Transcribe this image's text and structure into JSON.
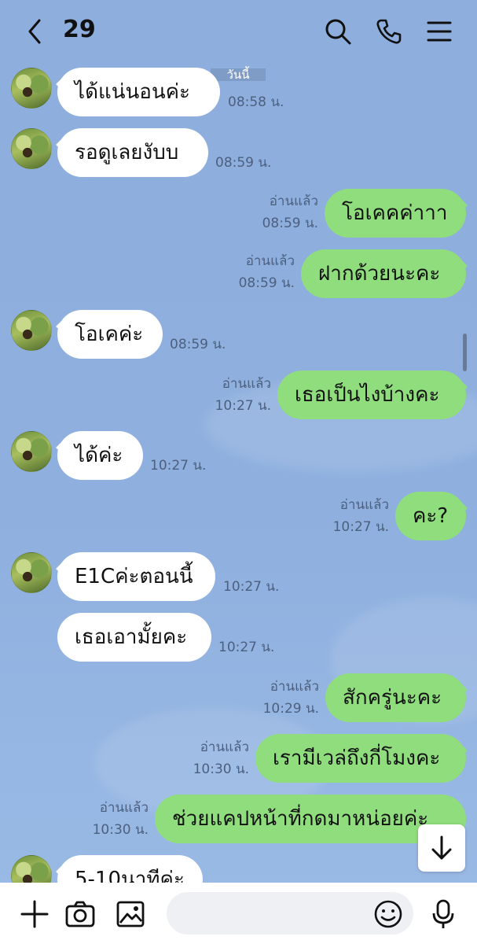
{
  "header": {
    "title": "29",
    "icons": [
      "back-icon",
      "search-icon",
      "phone-icon",
      "menu-icon"
    ]
  },
  "date_label": "วันนี้",
  "messages": [
    {
      "dir": "in",
      "text": "ได้แน่นอนค่ะ",
      "time": "08:58 น.",
      "read": ""
    },
    {
      "dir": "in",
      "text": "รอดูเลยงับบ",
      "time": "08:59 น.",
      "read": ""
    },
    {
      "dir": "out",
      "text": "โอเคคค่าาา",
      "time": "08:59 น.",
      "read": "อ่านแล้ว"
    },
    {
      "dir": "out",
      "text": "ฝากด้วยนะคะ",
      "time": "08:59 น.",
      "read": "อ่านแล้ว"
    },
    {
      "dir": "in",
      "text": "โอเคค่ะ",
      "time": "08:59 น.",
      "read": ""
    },
    {
      "dir": "out",
      "text": "เธอเป็นไงบ้างคะ",
      "time": "10:27 น.",
      "read": "อ่านแล้ว"
    },
    {
      "dir": "in",
      "text": "ได้ค่ะ",
      "time": "10:27 น.",
      "read": ""
    },
    {
      "dir": "out",
      "text": "คะ?",
      "time": "10:27 น.",
      "read": "อ่านแล้ว"
    },
    {
      "dir": "in",
      "text": "E1Cค่ะตอนนี้",
      "time": "10:27 น.",
      "read": ""
    },
    {
      "dir": "in",
      "text": "เธอเอามั้ยคะ",
      "time": "10:27 น.",
      "read": ""
    },
    {
      "dir": "out",
      "text": "สักครู่นะคะ",
      "time": "10:29 น.",
      "read": "อ่านแล้ว"
    },
    {
      "dir": "out",
      "text": "เรามีเวล่ถึงกี่โมงคะ",
      "time": "10:30 น.",
      "read": "อ่านแล้ว"
    },
    {
      "dir": "out",
      "text": "ช่วยแคปหน้าที่กดมาหน่อยค่ะ",
      "time": "10:30 น.",
      "read": "อ่านแล้ว"
    },
    {
      "dir": "in",
      "text": "5-10นาทีค่ะ",
      "time": "",
      "read": ""
    }
  ],
  "composer": {
    "placeholder": "",
    "icons": [
      "plus-icon",
      "camera-icon",
      "image-icon",
      "emoji-icon",
      "mic-icon"
    ]
  },
  "colors": {
    "background": "#8eaedd",
    "outgoing": "#8fdd7c",
    "incoming": "#ffffff"
  }
}
